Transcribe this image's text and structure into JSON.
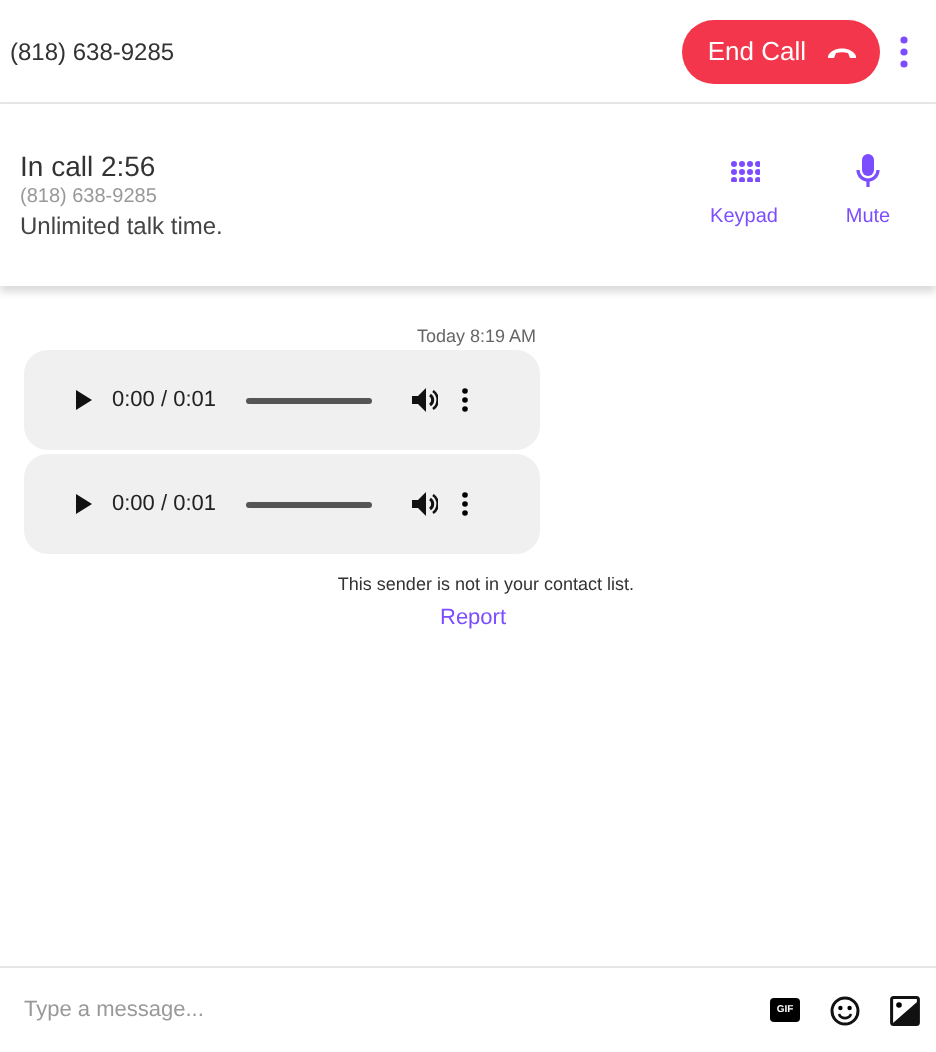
{
  "header": {
    "phone": "(818) 638-9285",
    "end_call": "End Call"
  },
  "call": {
    "status": "In call 2:56",
    "phone": "(818) 638-9285",
    "plan": "Unlimited talk time.",
    "actions": [
      {
        "kind": "keypad",
        "label": "Keypad"
      },
      {
        "kind": "mute",
        "label": "Mute"
      }
    ]
  },
  "messages": {
    "timestamp": "Today 8:19 AM",
    "audio": [
      {
        "time": "0:00 / 0:01"
      },
      {
        "time": "0:00 / 0:01"
      }
    ],
    "notice": "This sender is not in your contact list.",
    "report": "Report"
  },
  "composer": {
    "placeholder": "Type a message...",
    "gif": "GIF"
  }
}
